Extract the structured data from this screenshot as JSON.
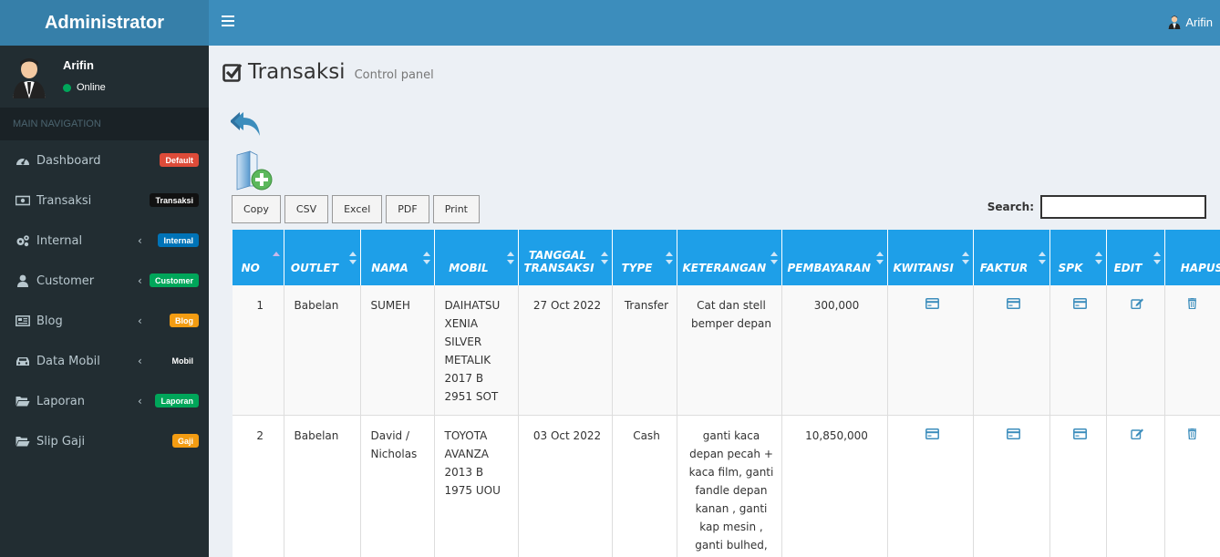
{
  "sidebar": {
    "brand": "Administrator",
    "user": {
      "name": "Arifin",
      "status": "Online"
    },
    "nav_header": "MAIN NAVIGATION",
    "items": [
      {
        "label": "Dashboard",
        "badge": "Default",
        "badge_color": "#dd4b39",
        "chevron": false,
        "icon": "dashboard-icon"
      },
      {
        "label": "Transaksi",
        "badge": "Transaksi",
        "badge_color": "#111111",
        "chevron": false,
        "icon": "money-icon"
      },
      {
        "label": "Internal",
        "badge": "Internal",
        "badge_color": "#0073b7",
        "chevron": true,
        "icon": "cogs-icon"
      },
      {
        "label": "Customer",
        "badge": "Customer",
        "badge_color": "#00a65a",
        "chevron": true,
        "icon": "user-icon"
      },
      {
        "label": "Blog",
        "badge": "Blog",
        "badge_color": "#f39c12",
        "chevron": true,
        "icon": "newspaper-icon"
      },
      {
        "label": "Data Mobil",
        "badge": "Mobil",
        "badge_color": "#222d32",
        "chevron": true,
        "icon": "car-icon"
      },
      {
        "label": "Laporan",
        "badge": "Laporan",
        "badge_color": "#00a65a",
        "chevron": true,
        "icon": "folder-open-icon"
      },
      {
        "label": "Slip Gaji",
        "badge": "Gaji",
        "badge_color": "#f39c12",
        "chevron": false,
        "icon": "folder-open-icon"
      }
    ]
  },
  "header": {
    "user_name": "Arifin"
  },
  "page": {
    "title": "Transaksi",
    "subtitle": "Control panel"
  },
  "toolbar": {
    "buttons": [
      "Copy",
      "CSV",
      "Excel",
      "PDF",
      "Print"
    ]
  },
  "search": {
    "label": "Search:",
    "value": ""
  },
  "table": {
    "columns": [
      "NO",
      "OUTLET",
      "NAMA",
      "MOBIL",
      "TANGGAL TRANSAKSI",
      "TYPE",
      "KETERANGAN",
      "PEMBAYARAN",
      "KWITANSI",
      "FAKTUR",
      "SPK",
      "EDIT",
      "HAPUS"
    ],
    "rows": [
      {
        "no": "1",
        "outlet": "Babelan",
        "nama": "SUMEH",
        "mobil": "DAIHATSU XENIA SILVER METALIK 2017 B 2951 SOT",
        "tanggal": "27 Oct 2022",
        "type": "Transfer",
        "keterangan": "Cat dan stell bemper depan",
        "pembayaran": "300,000"
      },
      {
        "no": "2",
        "outlet": "Babelan",
        "nama": "David / Nicholas",
        "mobil": "TOYOTA AVANZA 2013 B 1975 UOU",
        "tanggal": "03 Oct 2022",
        "type": "Cash",
        "keterangan": "ganti kaca depan pecah + kaca film, ganti fandle depan kanan , ganti kap mesin , ganti bulhed, ganti lampu",
        "pembayaran": "10,850,000"
      }
    ]
  },
  "colors": {
    "header_bg": "#3c8dbc",
    "logo_bg": "#367fa9",
    "sidebar_bg": "#222d32",
    "table_head": "#1e9fe8",
    "icon_blue": "#3c8dbc"
  }
}
